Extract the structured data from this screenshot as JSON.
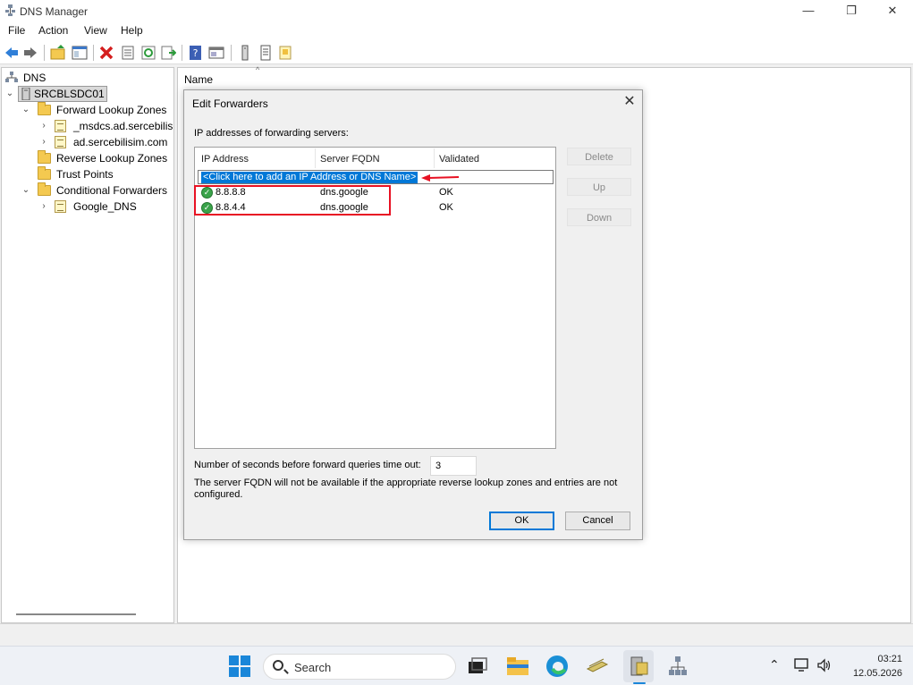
{
  "window": {
    "title": "DNS Manager",
    "controls": {
      "minimize": "—",
      "restore": "❐",
      "close": "✕"
    }
  },
  "menu": [
    "File",
    "Action",
    "View",
    "Help"
  ],
  "toolbar": {
    "icons": [
      "back-arrow-icon",
      "forward-arrow-icon",
      "up-folder-icon",
      "show-hide-tree-icon",
      "delete-icon",
      "properties-icon",
      "refresh-icon",
      "export-list-icon",
      "help-icon",
      "console-icon",
      "server-icon",
      "zone-icon"
    ]
  },
  "tree": {
    "root": "DNS",
    "server": "SRCBLSDC01",
    "items": [
      {
        "label": "Forward Lookup Zones"
      },
      {
        "label": "_msdcs.ad.sercebilisim.com"
      },
      {
        "label": "ad.sercebilisim.com"
      },
      {
        "label": "Reverse Lookup Zones"
      },
      {
        "label": "Trust Points"
      },
      {
        "label": "Conditional Forwarders"
      },
      {
        "label": "Google_DNS"
      }
    ]
  },
  "content": {
    "column_name": "Name",
    "sort_glyph": "^"
  },
  "dialog": {
    "title": "Edit Forwarders",
    "close": "✕",
    "caption": "IP addresses of forwarding servers:",
    "columns": [
      "IP Address",
      "Server FQDN",
      "Validated"
    ],
    "add_prompt": "<Click here to add an IP Address or DNS Name>",
    "rows": [
      {
        "status_icon": "check",
        "ip": "8.8.8.8",
        "fqdn": "dns.google",
        "validated": "OK"
      },
      {
        "status_icon": "check",
        "ip": "8.8.4.4",
        "fqdn": "dns.google",
        "validated": "OK"
      }
    ],
    "buttons": {
      "delete": "Delete",
      "up": "Up",
      "down": "Down",
      "ok": "OK",
      "cancel": "Cancel"
    },
    "timeout_label": "Number of seconds before forward queries time out:",
    "timeout_value": "3",
    "note": "The server FQDN will not be available if the appropriate reverse lookup zones and entries are not configured.",
    "annotation_color": "#e81123"
  },
  "taskbar": {
    "search_placeholder": "Search",
    "apps": [
      "windows-start-icon",
      "task-view-icon",
      "file-explorer-icon",
      "edge-icon",
      "dns-tool-icon",
      "server-manager-icon",
      "network-icon"
    ],
    "tray_icons": [
      "chevron-up-icon",
      "network-monitor-icon",
      "speaker-icon"
    ],
    "time": "03:21",
    "date": "12.05.2026"
  }
}
